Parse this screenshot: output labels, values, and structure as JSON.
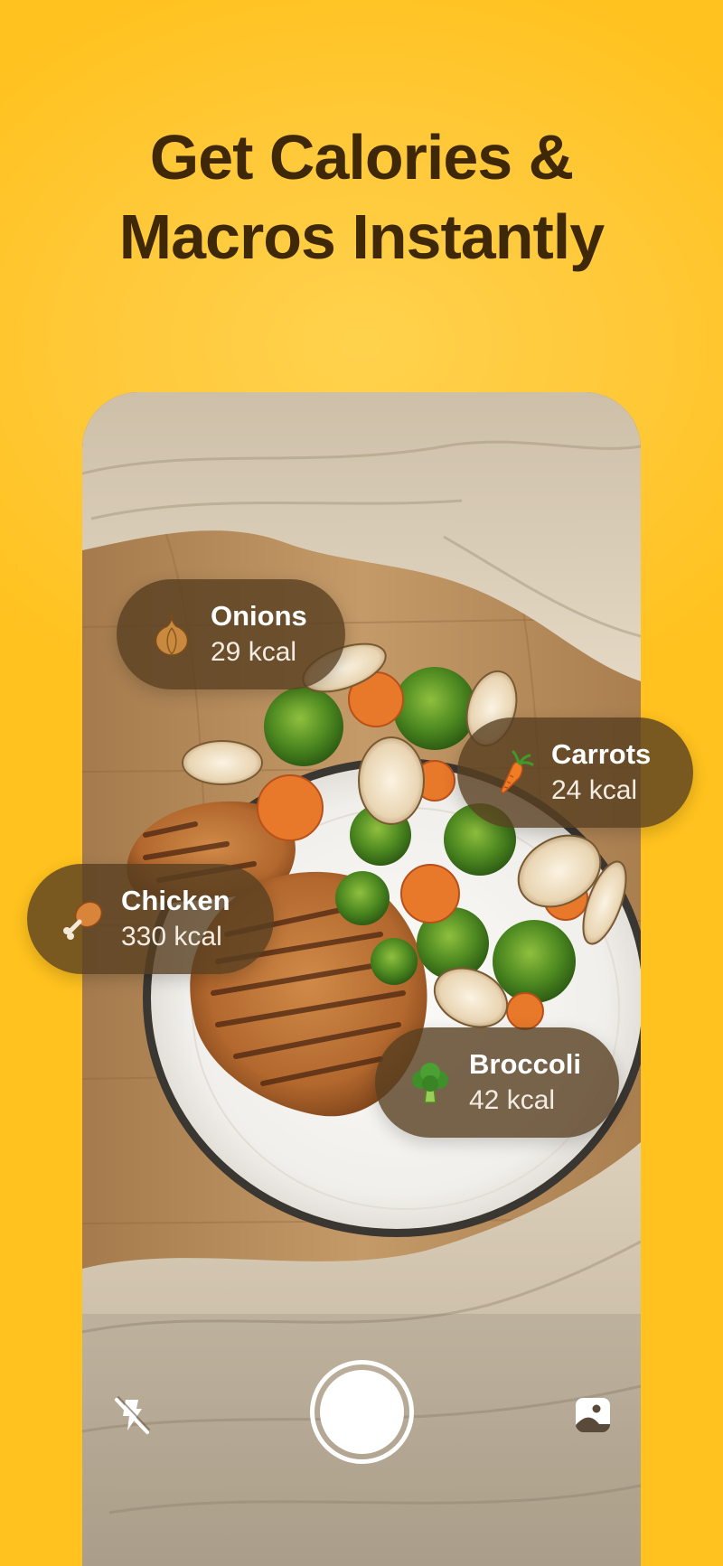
{
  "headline": {
    "line1": "Get Calories &",
    "line2": "Macros Instantly"
  },
  "food_items": [
    {
      "icon": "onion-icon",
      "name": "Onions",
      "kcal": "29 kcal"
    },
    {
      "icon": "carrot-icon",
      "name": "Carrots",
      "kcal": "24 kcal"
    },
    {
      "icon": "chicken-leg-icon",
      "name": "Chicken",
      "kcal": "330 kcal"
    },
    {
      "icon": "broccoli-icon",
      "name": "Broccoli",
      "kcal": "42 kcal"
    }
  ],
  "camera_controls": {
    "flash": "flash-off-icon",
    "shutter": "shutter-button",
    "gallery": "gallery-icon"
  },
  "colors": {
    "background": "#ffc21e",
    "headline": "#3e2808",
    "chip": "#583e20",
    "chip_text": "#ffffff"
  }
}
